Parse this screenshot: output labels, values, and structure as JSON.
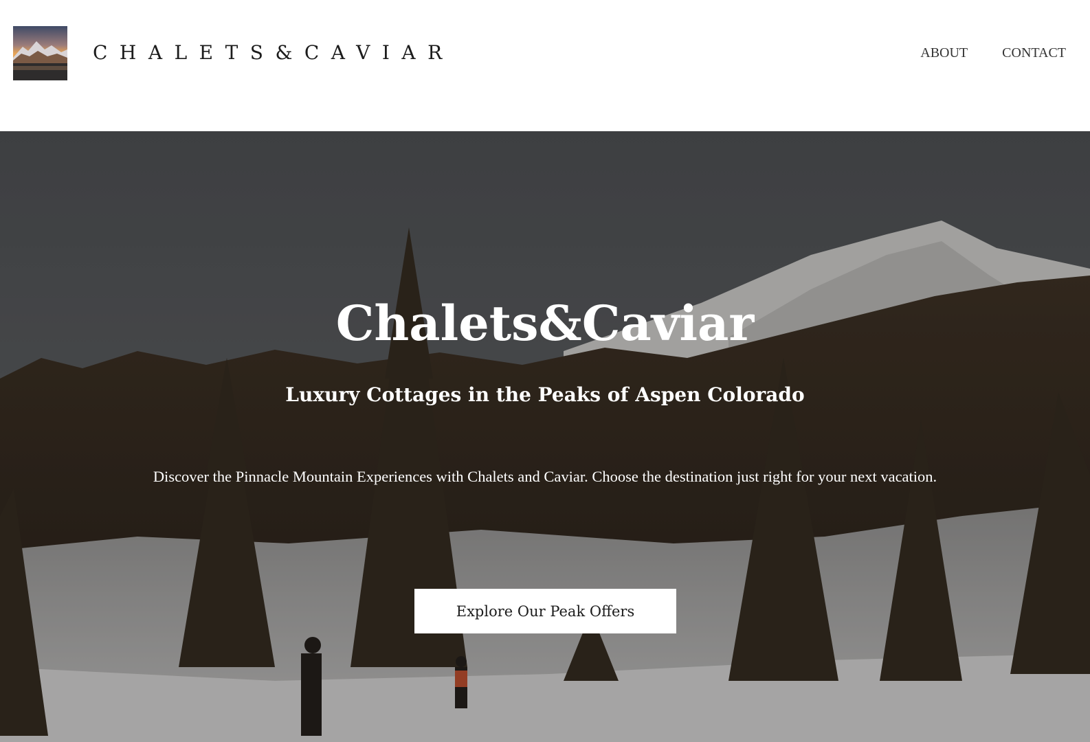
{
  "header": {
    "logo_alt": "mountain lake at sunset thumbnail",
    "brand": "CHALETS&CAVIAR",
    "nav": [
      {
        "label": "ABOUT"
      },
      {
        "label": "CONTACT"
      }
    ]
  },
  "hero": {
    "title": "Chalets&Caviar",
    "subtitle": "Luxury Cottages in the Peaks of Aspen Colorado",
    "description": "Discover the Pinnacle Mountain Experiences with Chalets and Caviar. Choose the destination just right for your next vacation.",
    "cta_label": "Explore Our Peak Offers"
  },
  "colors": {
    "header_bg": "#ffffff",
    "brand_text": "#1c1c1c",
    "nav_text": "#333333",
    "hero_text": "#ffffff",
    "cta_bg": "#ffffff",
    "cta_text": "#1c1c1c"
  }
}
